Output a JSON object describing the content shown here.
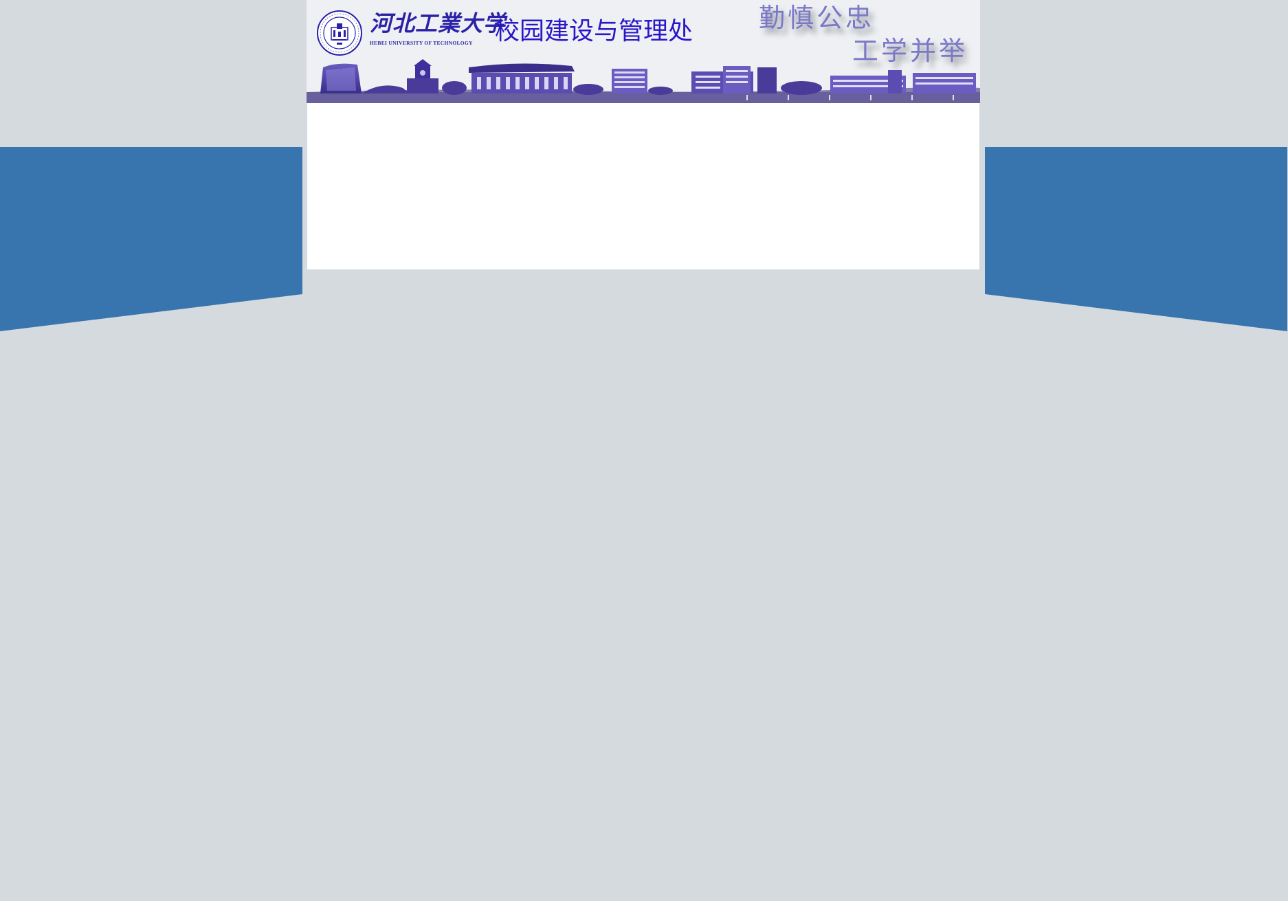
{
  "header": {
    "university_name_cn": "河北工業大学",
    "university_name_en": "HEBEI UNIVERSITY OF TECHNOLOGY",
    "department_title": "校园建设与管理处",
    "motto_line1": "勤慎公忠",
    "motto_line2": "工学并举",
    "seal_icon": "university-seal-icon",
    "skyline_image": "campus-skyline-image"
  },
  "colors": {
    "page_background": "#d5dadf",
    "side_band": "#3874ae",
    "header_background": "#eef0f3",
    "title_blue": "#2a17c8",
    "motto_purple": "#7a78c8",
    "skyline_purple": "#4a3a9a",
    "content_background": "#ffffff"
  }
}
